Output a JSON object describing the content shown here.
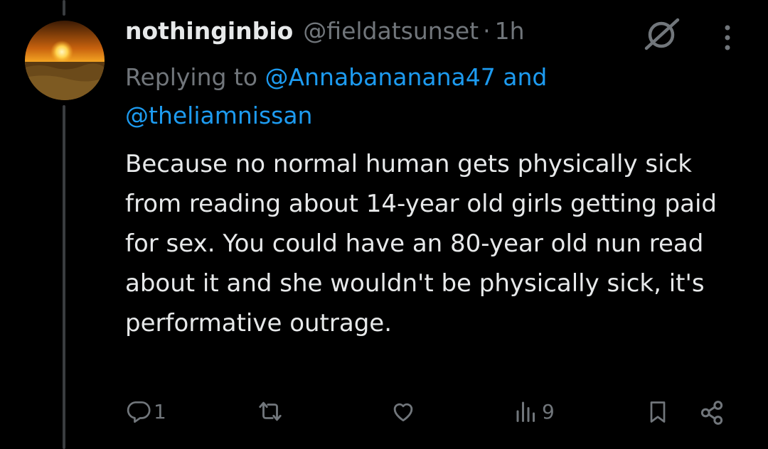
{
  "tweet": {
    "display_name": "nothinginbio",
    "handle": "@fieldatsunset",
    "separator": "·",
    "time": "1h",
    "replying_label": "Replying to",
    "mention_1": "@Annabananana47",
    "and_word": "and",
    "mention_2": "@theliamnissan",
    "body": "Because no normal human gets physically sick from reading about 14-year old girls getting paid for sex. You could have an 80-year old nun read about it and she wouldn't be physically sick, it's performative outrage."
  },
  "actions": {
    "reply_count": "1",
    "views_count": "9"
  },
  "icons": [
    "reply-icon",
    "retweet-icon",
    "like-icon",
    "views-icon",
    "bookmark-icon",
    "share-icon",
    "grok-icon",
    "more-icon"
  ],
  "colors": {
    "background": "#000000",
    "text": "#e7e9ea",
    "muted": "#71767b",
    "link": "#1d9bf0"
  }
}
